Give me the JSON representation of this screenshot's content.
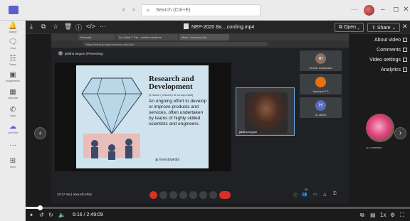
{
  "titlebar": {
    "search_placeholder": "Search (Ctrl+E)",
    "more": "···",
    "min": "–",
    "max": "◻",
    "close": "✕"
  },
  "rail": [
    {
      "label": "Activity",
      "icon": "bell-icon",
      "glyph": "🔔"
    },
    {
      "label": "Chat",
      "icon": "chat-icon",
      "glyph": "💬"
    },
    {
      "label": "Teams",
      "icon": "teams-icon",
      "glyph": "👥"
    },
    {
      "label": "Assignments",
      "icon": "assignments-icon",
      "glyph": "🎒"
    },
    {
      "label": "Calendar",
      "icon": "calendar-icon",
      "glyph": "▦"
    },
    {
      "label": "Calls",
      "icon": "phone-icon",
      "glyph": "✆"
    },
    {
      "label": "OneDrive",
      "icon": "cloud-icon",
      "glyph": "☁"
    },
    {
      "label": "···",
      "icon": "more-icon",
      "glyph": ""
    },
    {
      "label": "Apps",
      "icon": "apps-icon",
      "glyph": "⊞"
    }
  ],
  "viewer": {
    "file_name": "NEP-2020 8a....cording.mp4",
    "open_label": "Open",
    "share_label": "Share",
    "menu": [
      "About video",
      "Comments",
      "Video settings",
      "Analytics"
    ]
  },
  "browser": {
    "tabs": [
      "Recorde...",
      "Dr. Kalim T. Fai - mrsfice.students",
      "Meet - mxa-sfcx-fbd"
    ],
    "url": "https://meet.google.com/mxa-sfcx-fbd"
  },
  "meet": {
    "presenter": "jahitha begum (Presenting)",
    "slide": {
      "title_line1": "Research and",
      "title_line2": "Development",
      "phonetic": "[ri-'sarch (ˈrēsərch) di-'ve-lap-mant]",
      "text": "An ongoing effort to develop or improve products and services, often undertaken by teams of highly skilled scientists and engineers.",
      "logo": "Investopedia"
    },
    "speaker_name": "jahitha begum",
    "tiles": [
      {
        "initial": "m",
        "name": "mmrktc coordinator",
        "color": "#8d6e63"
      },
      {
        "initial": "",
        "name": "Sreedevi P S",
        "color": "#e8710a"
      },
      {
        "initial": "H",
        "name": "32 others",
        "color": "#5c6bc0"
      }
    ],
    "time": "10:17 AM",
    "meeting_code": "mxa-sfcx-fbd",
    "participants_count": "39"
  },
  "side_tile_name": "p.c.sreedevi",
  "player": {
    "current": "6:16",
    "total": "2:49:09",
    "progress": 0.037
  }
}
